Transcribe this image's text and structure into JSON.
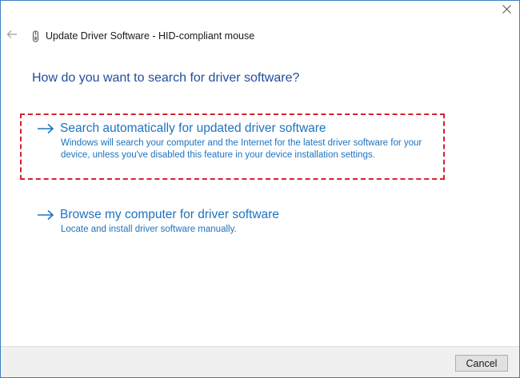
{
  "window": {
    "title": "Update Driver Software - HID-compliant mouse"
  },
  "icons": {
    "close": "close-icon",
    "back": "back-arrow-icon",
    "device": "mouse-device-icon",
    "option_arrow": "right-arrow-icon"
  },
  "main": {
    "question": "How do you want to search for driver software?",
    "options": [
      {
        "title": "Search automatically for updated driver software",
        "description": "Windows will search your computer and the Internet for the latest driver software for your device, unless you've disabled this feature in your device installation settings."
      },
      {
        "title": "Browse my computer for driver software",
        "description": "Locate and install driver software manually."
      }
    ]
  },
  "footer": {
    "cancel_label": "Cancel"
  },
  "colors": {
    "accent": "#1e73be",
    "heading": "#1f4e9c",
    "highlight": "#d9202e",
    "window_border": "#3d7fc4"
  }
}
